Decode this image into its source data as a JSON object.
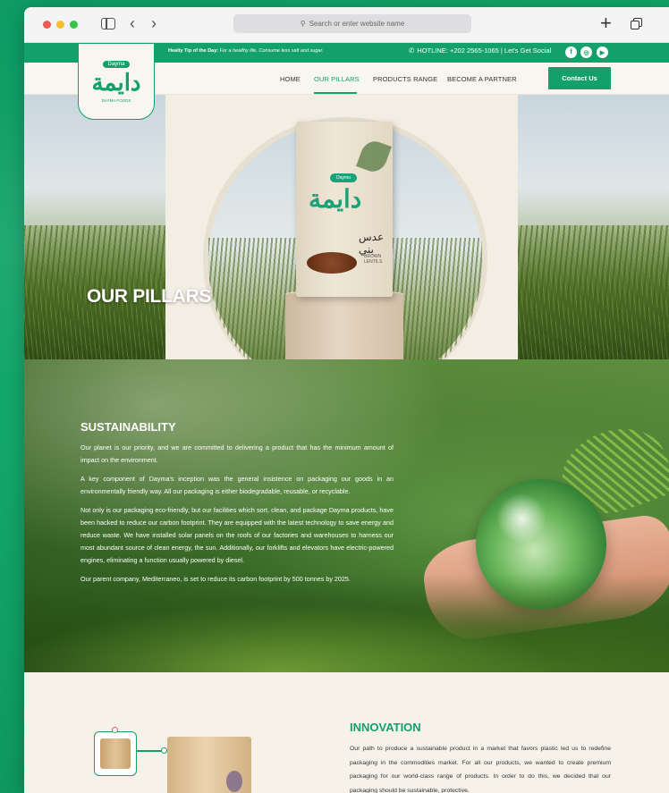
{
  "browser": {
    "address_placeholder": "Search or enter website name",
    "back_glyph": "‹",
    "forward_glyph": "›",
    "new_tab_glyph": "+"
  },
  "topbar": {
    "tip_label": "Healty Tip of the Day:",
    "tip_text": "For a healthy life, Consume less salt and sugar.",
    "hotline": "HOTLINE: +202 2565-1065 | Let's Get Social",
    "social": [
      "f",
      "◎",
      "▶"
    ]
  },
  "logo": {
    "badge": "Dayma",
    "arabic": "دايمة",
    "sub": "DAYMA FOODS"
  },
  "nav": {
    "items": [
      "HOME",
      "OUR PILLARS",
      "PRODUCTS RANGE",
      "BECOME A PARTNER"
    ],
    "active": "OUR PILLARS",
    "contact": "Contact Us"
  },
  "hero": {
    "title": "OUR PILLARS",
    "bag": {
      "badge": "Dayma",
      "arabic": "دايمة",
      "label_ar": "عدس بني",
      "label_en": "BROWN LENTILS"
    }
  },
  "sustainability": {
    "title": "SUSTAINABILITY",
    "paragraphs": [
      "Our planet is our priority, and we are committed to delivering a product that has the minimum amount of impact on the environment.",
      "A key component of Dayma's inception was the general insistence on packaging our goods in an environmentally friendly way. All our packaging is either biodegradable, reusable, or recyclable.",
      "Not only is our packaging eco-friendly, but our facilities which sort, clean, and package Dayma products, have been hacked to reduce our carbon footprint. They are equipped with the latest technology to save energy and reduce waste. We have installed solar panels on the roofs of our factories and warehouses to harness our most abundant source of clean energy, the sun. Additionally, our forklifts and elevators have electric-powered engines, eliminating a function usually powered by diesel.",
      "Our parent company, Mediterraneo, is set to reduce its carbon footprint by 500 tonnes by 2025."
    ]
  },
  "innovation": {
    "title": "INNOVATION",
    "text": "Our path to produce a sustainable product in a market that favors plastic led us to redefine packaging in the commodities market. For all our products, we wanted to create premium packaging for our world-class range of products. In order to do this, we decided that our packaging should be sustainable, protective,"
  },
  "colors": {
    "brand_green": "#13a06a",
    "page_bg": "#0f9b63",
    "cream": "#f6f2ea"
  }
}
